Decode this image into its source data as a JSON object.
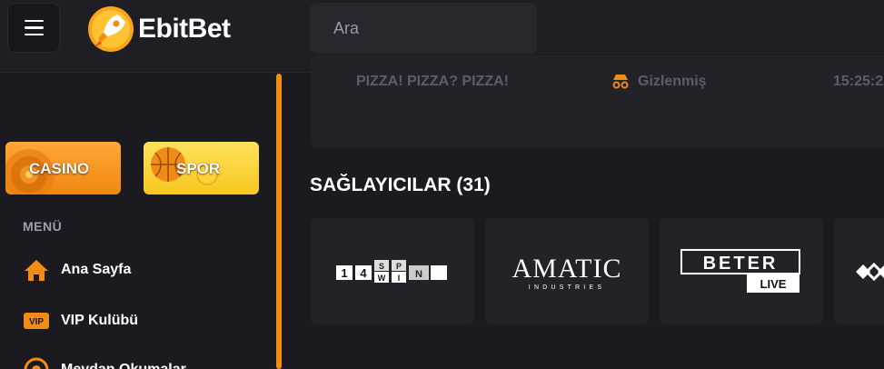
{
  "header": {
    "brand": "EbitBet",
    "search_placeholder": "Ara"
  },
  "sidebar": {
    "categories": [
      {
        "label": "CASINO"
      },
      {
        "label": "SPOR"
      }
    ],
    "menu_title": "MENÜ",
    "items": [
      {
        "label": "Ana Sayfa",
        "icon": "home-icon"
      },
      {
        "label": "VIP Kulübü",
        "icon": "vip-icon"
      },
      {
        "label": "Meydan Okumalar",
        "icon": "target-icon"
      }
    ]
  },
  "recent_bet": {
    "game": "PIZZA! PIZZA? PIZZA!",
    "user": "Gizlenmiş",
    "time": "15:25:2"
  },
  "providers": {
    "title": "SAĞLAYICILAR (31)",
    "items": [
      {
        "name": "1spin4win",
        "logo_text_digits": [
          "1",
          "4"
        ],
        "logo_text_letters": [
          "S",
          "P",
          "W",
          "I",
          "N"
        ]
      },
      {
        "name": "Amatic",
        "logo_main": "AMATIC",
        "logo_sub": "INDUSTRIES"
      },
      {
        "name": "Beter Live",
        "logo_main": "BETER",
        "logo_sub": "LIVE"
      },
      {
        "name": "partial-provider"
      }
    ]
  },
  "colors": {
    "accent": "#f28c14",
    "background": "#1b1a20",
    "card": "#232229"
  }
}
